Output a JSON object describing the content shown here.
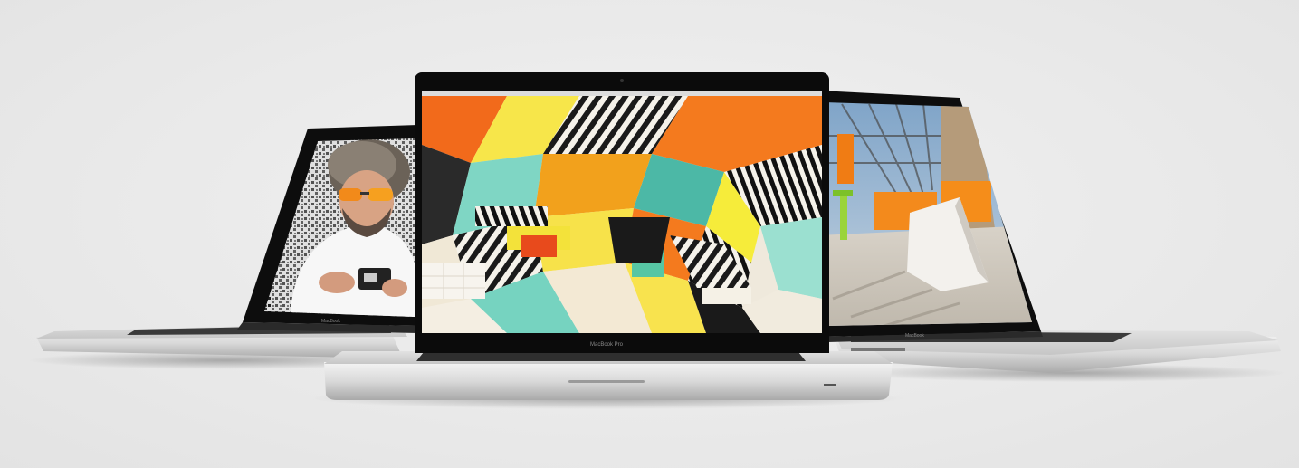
{
  "scene": {
    "background_color": "#ececec",
    "laptops": [
      {
        "id": "left",
        "screen_content": "portrait of man with curly hair and orange sunglasses holding camera",
        "logo_text": "MacBook"
      },
      {
        "id": "center",
        "screen_content": "colorful geometric striped art installation",
        "logo_text": "MacBook Pro"
      },
      {
        "id": "right",
        "screen_content": "atrium installation with orange banners and white sculpture",
        "logo_text": "MacBook"
      }
    ]
  }
}
